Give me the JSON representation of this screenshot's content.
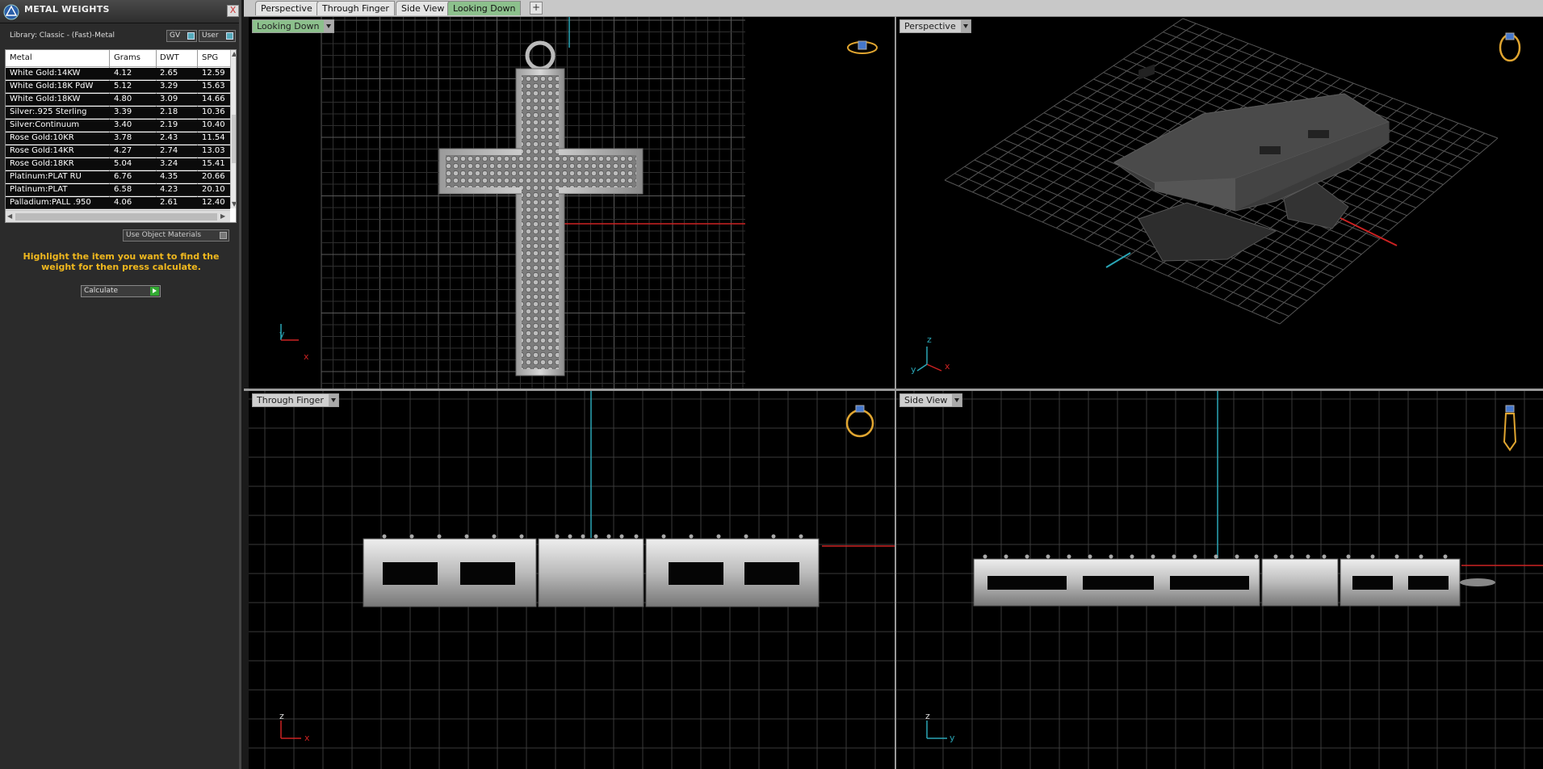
{
  "panel": {
    "title": "METAL WEIGHTS",
    "close_label": "X",
    "library": "Library: Classic - (Fast)-Metal",
    "toggle_gv": "GV",
    "toggle_user": "User",
    "columns": [
      "Metal",
      "Grams",
      "DWT",
      "SPG"
    ],
    "rows": [
      {
        "metal": "White Gold:14KW",
        "grams": "4.12",
        "dwt": "2.65",
        "spg": "12.59"
      },
      {
        "metal": "White Gold:18K PdW",
        "grams": "5.12",
        "dwt": "3.29",
        "spg": "15.63"
      },
      {
        "metal": "White Gold:18KW",
        "grams": "4.80",
        "dwt": "3.09",
        "spg": "14.66"
      },
      {
        "metal": "Silver:.925 Sterling",
        "grams": "3.39",
        "dwt": "2.18",
        "spg": "10.36"
      },
      {
        "metal": "Silver:Continuum",
        "grams": "3.40",
        "dwt": "2.19",
        "spg": "10.40"
      },
      {
        "metal": "Rose Gold:10KR",
        "grams": "3.78",
        "dwt": "2.43",
        "spg": "11.54"
      },
      {
        "metal": "Rose Gold:14KR",
        "grams": "4.27",
        "dwt": "2.74",
        "spg": "13.03"
      },
      {
        "metal": "Rose Gold:18KR",
        "grams": "5.04",
        "dwt": "3.24",
        "spg": "15.41"
      },
      {
        "metal": "Platinum:PLAT RU",
        "grams": "6.76",
        "dwt": "4.35",
        "spg": "20.66"
      },
      {
        "metal": "Platinum:PLAT",
        "grams": "6.58",
        "dwt": "4.23",
        "spg": "20.10"
      },
      {
        "metal": "Palladium:PALL .950",
        "grams": "4.06",
        "dwt": "2.61",
        "spg": "12.40"
      }
    ],
    "use_object_materials": "Use Object Materials",
    "hint": "Highlight the item you want to find the weight for then press calculate.",
    "calculate_label": "Calculate"
  },
  "tabs": [
    {
      "label": "Perspective",
      "active": false
    },
    {
      "label": "Through Finger",
      "active": false
    },
    {
      "label": "Side View",
      "active": false
    },
    {
      "label": "Looking Down",
      "active": true
    }
  ],
  "tab_add": "+",
  "viewports": {
    "looking_down": {
      "label": "Looking Down",
      "axis_a": "y",
      "axis_b": "x"
    },
    "perspective": {
      "label": "Perspective",
      "axis_a": "z",
      "axis_b": "x",
      "axis_c": "y"
    },
    "through_finger": {
      "label": "Through Finger",
      "axis_a": "z",
      "axis_b": "x"
    },
    "side_view": {
      "label": "Side View",
      "axis_a": "z",
      "axis_b": "y"
    }
  },
  "colors": {
    "accent_yellow": "#f0b81e",
    "active_tab_green": "#8cc08c",
    "grid_line": "#4a4a4a",
    "axis_red": "#cc2222",
    "axis_cyan": "#2aa5b5"
  }
}
